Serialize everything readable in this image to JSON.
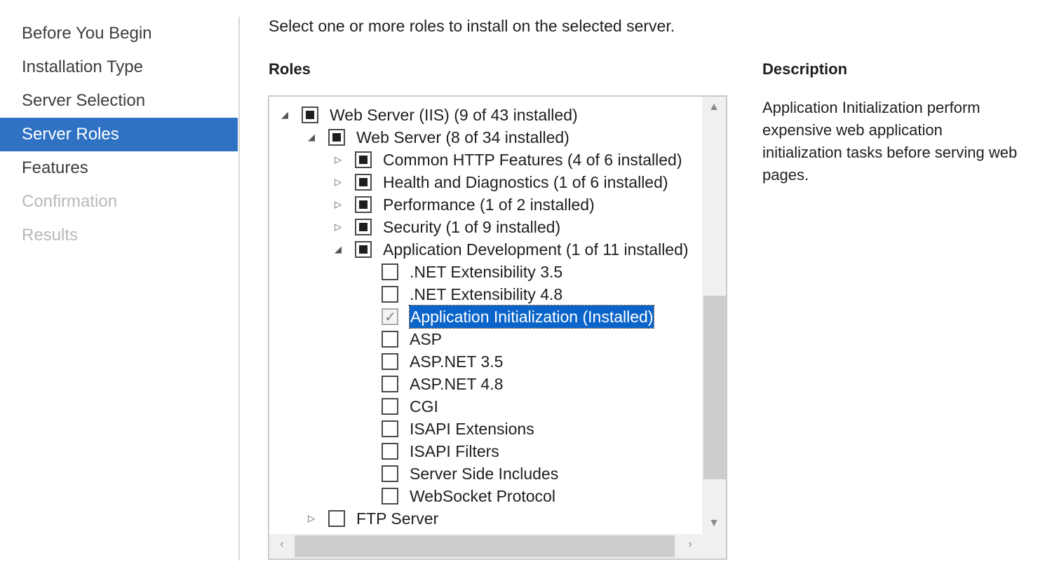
{
  "nav": {
    "items": [
      {
        "label": "Before You Begin",
        "state": "normal"
      },
      {
        "label": "Installation Type",
        "state": "normal"
      },
      {
        "label": "Server Selection",
        "state": "normal"
      },
      {
        "label": "Server Roles",
        "state": "active"
      },
      {
        "label": "Features",
        "state": "normal"
      },
      {
        "label": "Confirmation",
        "state": "disabled"
      },
      {
        "label": "Results",
        "state": "disabled"
      }
    ]
  },
  "header": {
    "instruction": "Select one or more roles to install on the selected server."
  },
  "roles": {
    "heading": "Roles",
    "tree": [
      {
        "level": 0,
        "expander": "expanded",
        "check": "partial",
        "label": "Web Server (IIS) (9 of 43 installed)"
      },
      {
        "level": 1,
        "expander": "expanded",
        "check": "partial",
        "label": "Web Server (8 of 34 installed)"
      },
      {
        "level": 2,
        "expander": "collapsed",
        "check": "partial",
        "label": "Common HTTP Features (4 of 6 installed)"
      },
      {
        "level": 2,
        "expander": "collapsed",
        "check": "partial",
        "label": "Health and Diagnostics (1 of 6 installed)"
      },
      {
        "level": 2,
        "expander": "collapsed",
        "check": "partial",
        "label": "Performance (1 of 2 installed)"
      },
      {
        "level": 2,
        "expander": "collapsed",
        "check": "partial",
        "label": "Security (1 of 9 installed)"
      },
      {
        "level": 2,
        "expander": "expanded",
        "check": "partial",
        "label": "Application Development (1 of 11 installed)"
      },
      {
        "level": 3,
        "expander": "none",
        "check": "unchecked",
        "label": ".NET Extensibility 3.5"
      },
      {
        "level": 3,
        "expander": "none",
        "check": "unchecked",
        "label": ".NET Extensibility 4.8"
      },
      {
        "level": 3,
        "expander": "none",
        "check": "checked-disabled",
        "label": "Application Initialization (Installed)",
        "selected": true
      },
      {
        "level": 3,
        "expander": "none",
        "check": "unchecked",
        "label": "ASP"
      },
      {
        "level": 3,
        "expander": "none",
        "check": "unchecked",
        "label": "ASP.NET 3.5"
      },
      {
        "level": 3,
        "expander": "none",
        "check": "unchecked",
        "label": "ASP.NET 4.8"
      },
      {
        "level": 3,
        "expander": "none",
        "check": "unchecked",
        "label": "CGI"
      },
      {
        "level": 3,
        "expander": "none",
        "check": "unchecked",
        "label": "ISAPI Extensions"
      },
      {
        "level": 3,
        "expander": "none",
        "check": "unchecked",
        "label": "ISAPI Filters"
      },
      {
        "level": 3,
        "expander": "none",
        "check": "unchecked",
        "label": "Server Side Includes"
      },
      {
        "level": 3,
        "expander": "none",
        "check": "unchecked",
        "label": "WebSocket Protocol"
      },
      {
        "level": 1,
        "expander": "collapsed",
        "check": "unchecked",
        "label": "FTP Server"
      }
    ]
  },
  "description": {
    "heading": "Description",
    "text": "Application Initialization perform expensive web application initialization tasks before serving web pages."
  },
  "scroll": {
    "up_icon": "▲",
    "down_icon": "▼",
    "left_icon": "‹",
    "right_icon": "›"
  },
  "colors": {
    "active_nav": "#2f72c3",
    "selection": "#0a64c9"
  }
}
